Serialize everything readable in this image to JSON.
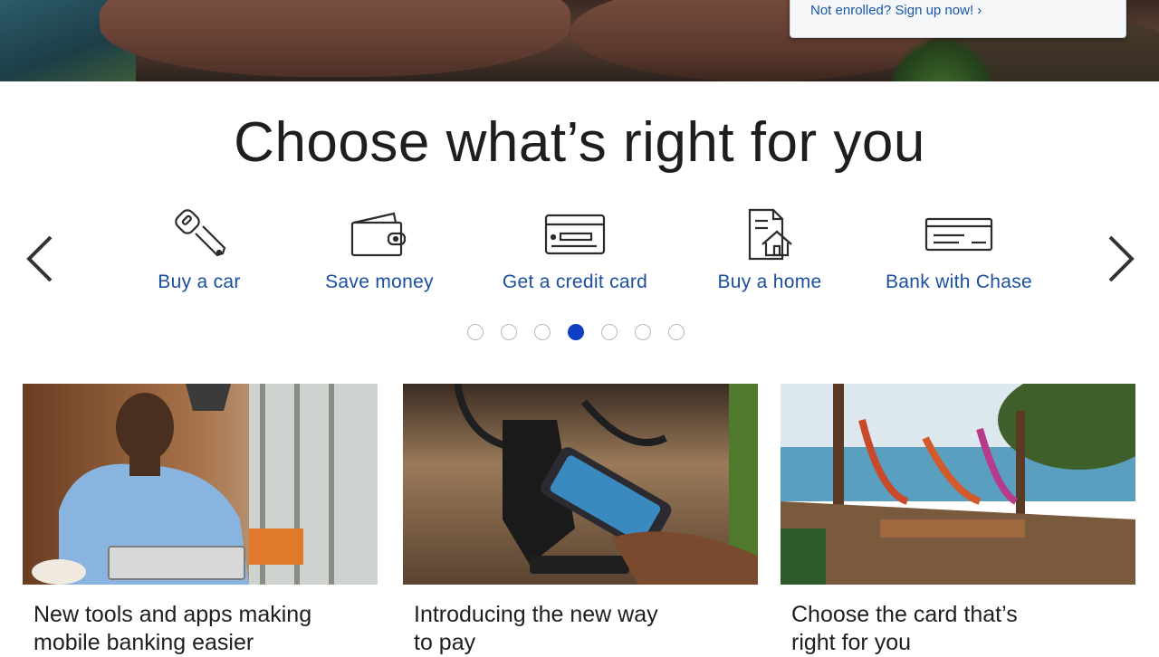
{
  "hero": {
    "signup_link": "Not enrolled? Sign up now! ›"
  },
  "section": {
    "title": "Choose what’s right for you"
  },
  "carousel": {
    "items": [
      {
        "label": "Buy a car",
        "icon": "car-key-icon"
      },
      {
        "label": "Save money",
        "icon": "wallet-icon"
      },
      {
        "label": "Get a credit card",
        "icon": "credit-card-icon"
      },
      {
        "label": "Buy a home",
        "icon": "house-document-icon"
      },
      {
        "label": "Bank with Chase",
        "icon": "check-icon"
      }
    ],
    "dot_count": 7,
    "active_dot": 4,
    "prev_icon": "chevron-left-icon",
    "next_icon": "chevron-right-icon"
  },
  "cards": [
    {
      "caption_line1": "New tools and apps making",
      "caption_line2": "mobile banking easier"
    },
    {
      "caption_line1": "Introducing the new way",
      "caption_line2": "to pay"
    },
    {
      "caption_line1": "Choose the card that’s",
      "caption_line2": "right for you"
    }
  ],
  "colors": {
    "link_blue": "#1a4fa0",
    "active_dot": "#0f3fc2",
    "title_text": "#1e1e1e"
  }
}
